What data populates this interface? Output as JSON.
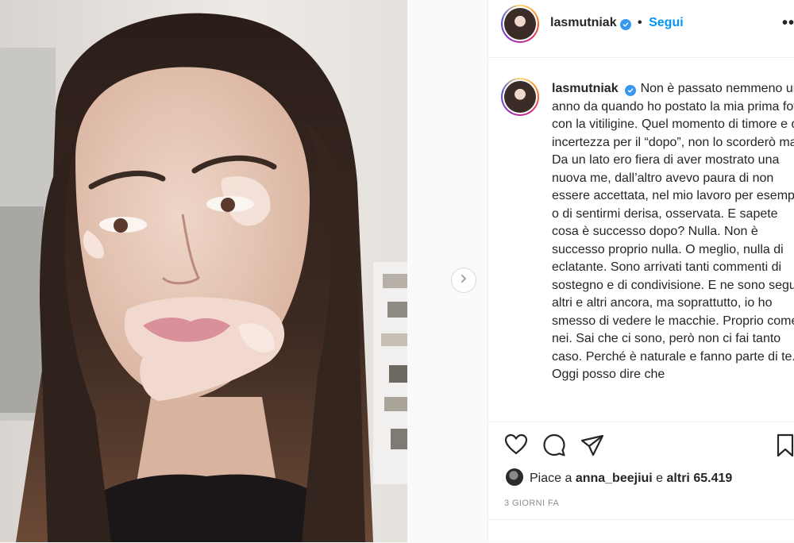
{
  "post": {
    "username": "lasmutniak",
    "follow_label": "Segui",
    "separator": "•",
    "more_label": "•••",
    "caption": "Non è passato nemmeno un anno da quando ho postato la mia prima foto con la vitiligine. Quel momento di timore e di incertezza per il “dopo”, non lo scorderò mai. Da un lato ero fiera di aver mostrato una nuova me, dall’altro avevo paura di non essere accettata, nel mio lavoro per esempio o di sentirmi derisa, osservata. E sapete cosa è successo dopo? Nulla. Non è successo proprio nulla. O meglio, nulla di eclatante. Sono arrivati tanti commenti di sostegno e di condivisione. E ne sono seguiti altri e altri ancora, ma soprattutto, io ho smesso di vedere le macchie. Proprio come i nei. Sai che ci sono, però non ci fai tanto caso. Perché è naturale e fanno parte di te. Oggi posso dire che",
    "likes_prefix": "Piace a ",
    "liked_by": "anna_beejiui",
    "likes_joiner": " e ",
    "likes_others": "altri 65.419",
    "timestamp": "3 GIORNI FA"
  },
  "icons": {
    "verified": "verified-badge-icon",
    "like": "heart-icon",
    "comment": "comment-bubble-icon",
    "share": "paper-plane-icon",
    "save": "bookmark-icon",
    "next": "chevron-right-icon"
  },
  "colors": {
    "accent": "#0095f6",
    "verified": "#3897f0",
    "border": "#efefef",
    "muted": "#8e8e8e"
  }
}
